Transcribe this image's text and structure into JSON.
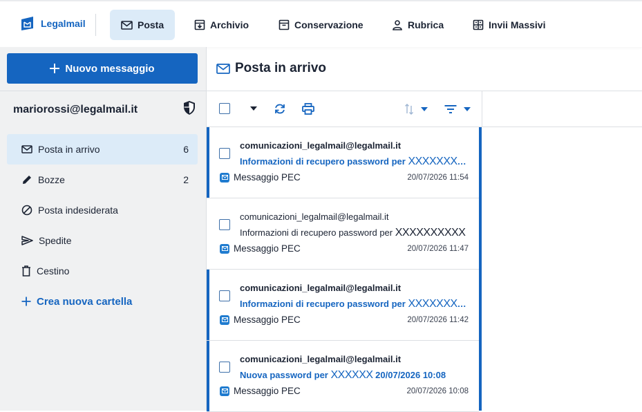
{
  "nav": {
    "brand": "Legalmail",
    "items": [
      {
        "label": "Posta",
        "icon": "envelope-icon",
        "active": true
      },
      {
        "label": "Archivio",
        "icon": "archive-icon",
        "active": false
      },
      {
        "label": "Conservazione",
        "icon": "storage-box-icon",
        "active": false
      },
      {
        "label": "Rubrica",
        "icon": "person-icon",
        "active": false
      },
      {
        "label": "Invii Massivi",
        "icon": "mass-send-icon",
        "active": false
      }
    ]
  },
  "sidebar": {
    "compose_label": "Nuovo messaggio",
    "account": "mariorossi@legalmail.it",
    "folders": [
      {
        "label": "Posta in arrivo",
        "count": "6",
        "icon": "inbox-icon",
        "active": true
      },
      {
        "label": "Bozze",
        "count": "2",
        "icon": "pencil-icon",
        "active": false
      },
      {
        "label": "Posta indesiderata",
        "count": "",
        "icon": "blocked-icon",
        "active": false
      },
      {
        "label": "Spedite",
        "count": "",
        "icon": "send-icon",
        "active": false
      },
      {
        "label": "Cestino",
        "count": "",
        "icon": "trash-icon",
        "active": false
      }
    ],
    "new_folder_label": "Crea nuova cartella"
  },
  "main": {
    "title": "Posta in arrivo",
    "messages": [
      {
        "sender": "comunicazioni_legalmail@legalmail.it",
        "subject_text": "Informazioni di recupero password per",
        "subject_redacted": "XXXXXXXXXX",
        "type": "Messaggio PEC",
        "date": "20/07/2026 11:54",
        "unread": true
      },
      {
        "sender": "comunicazioni_legalmail@legalmail.it",
        "subject_text": "Informazioni di recupero password per",
        "subject_redacted": "XXXXXXXXXX",
        "type": "Messaggio PEC",
        "date": "20/07/2026 11:47",
        "unread": false
      },
      {
        "sender": "comunicazioni_legalmail@legalmail.it",
        "subject_text": "Informazioni di recupero password per",
        "subject_redacted": "XXXXXXXXXX",
        "type": "Messaggio PEC",
        "date": "20/07/2026 11:42",
        "unread": true
      },
      {
        "sender": "comunicazioni_legalmail@legalmail.it",
        "subject_text": "Nuova password per",
        "subject_redacted": "XXXXXX",
        "subject_suffix": "20/07/2026 10:08",
        "type": "Messaggio PEC",
        "date": "20/07/2026 10:08",
        "unread": true
      }
    ]
  },
  "colors": {
    "accent": "#1565c0",
    "active_bg": "#dcebf8",
    "sidebar_bg": "#f0f1f2"
  }
}
